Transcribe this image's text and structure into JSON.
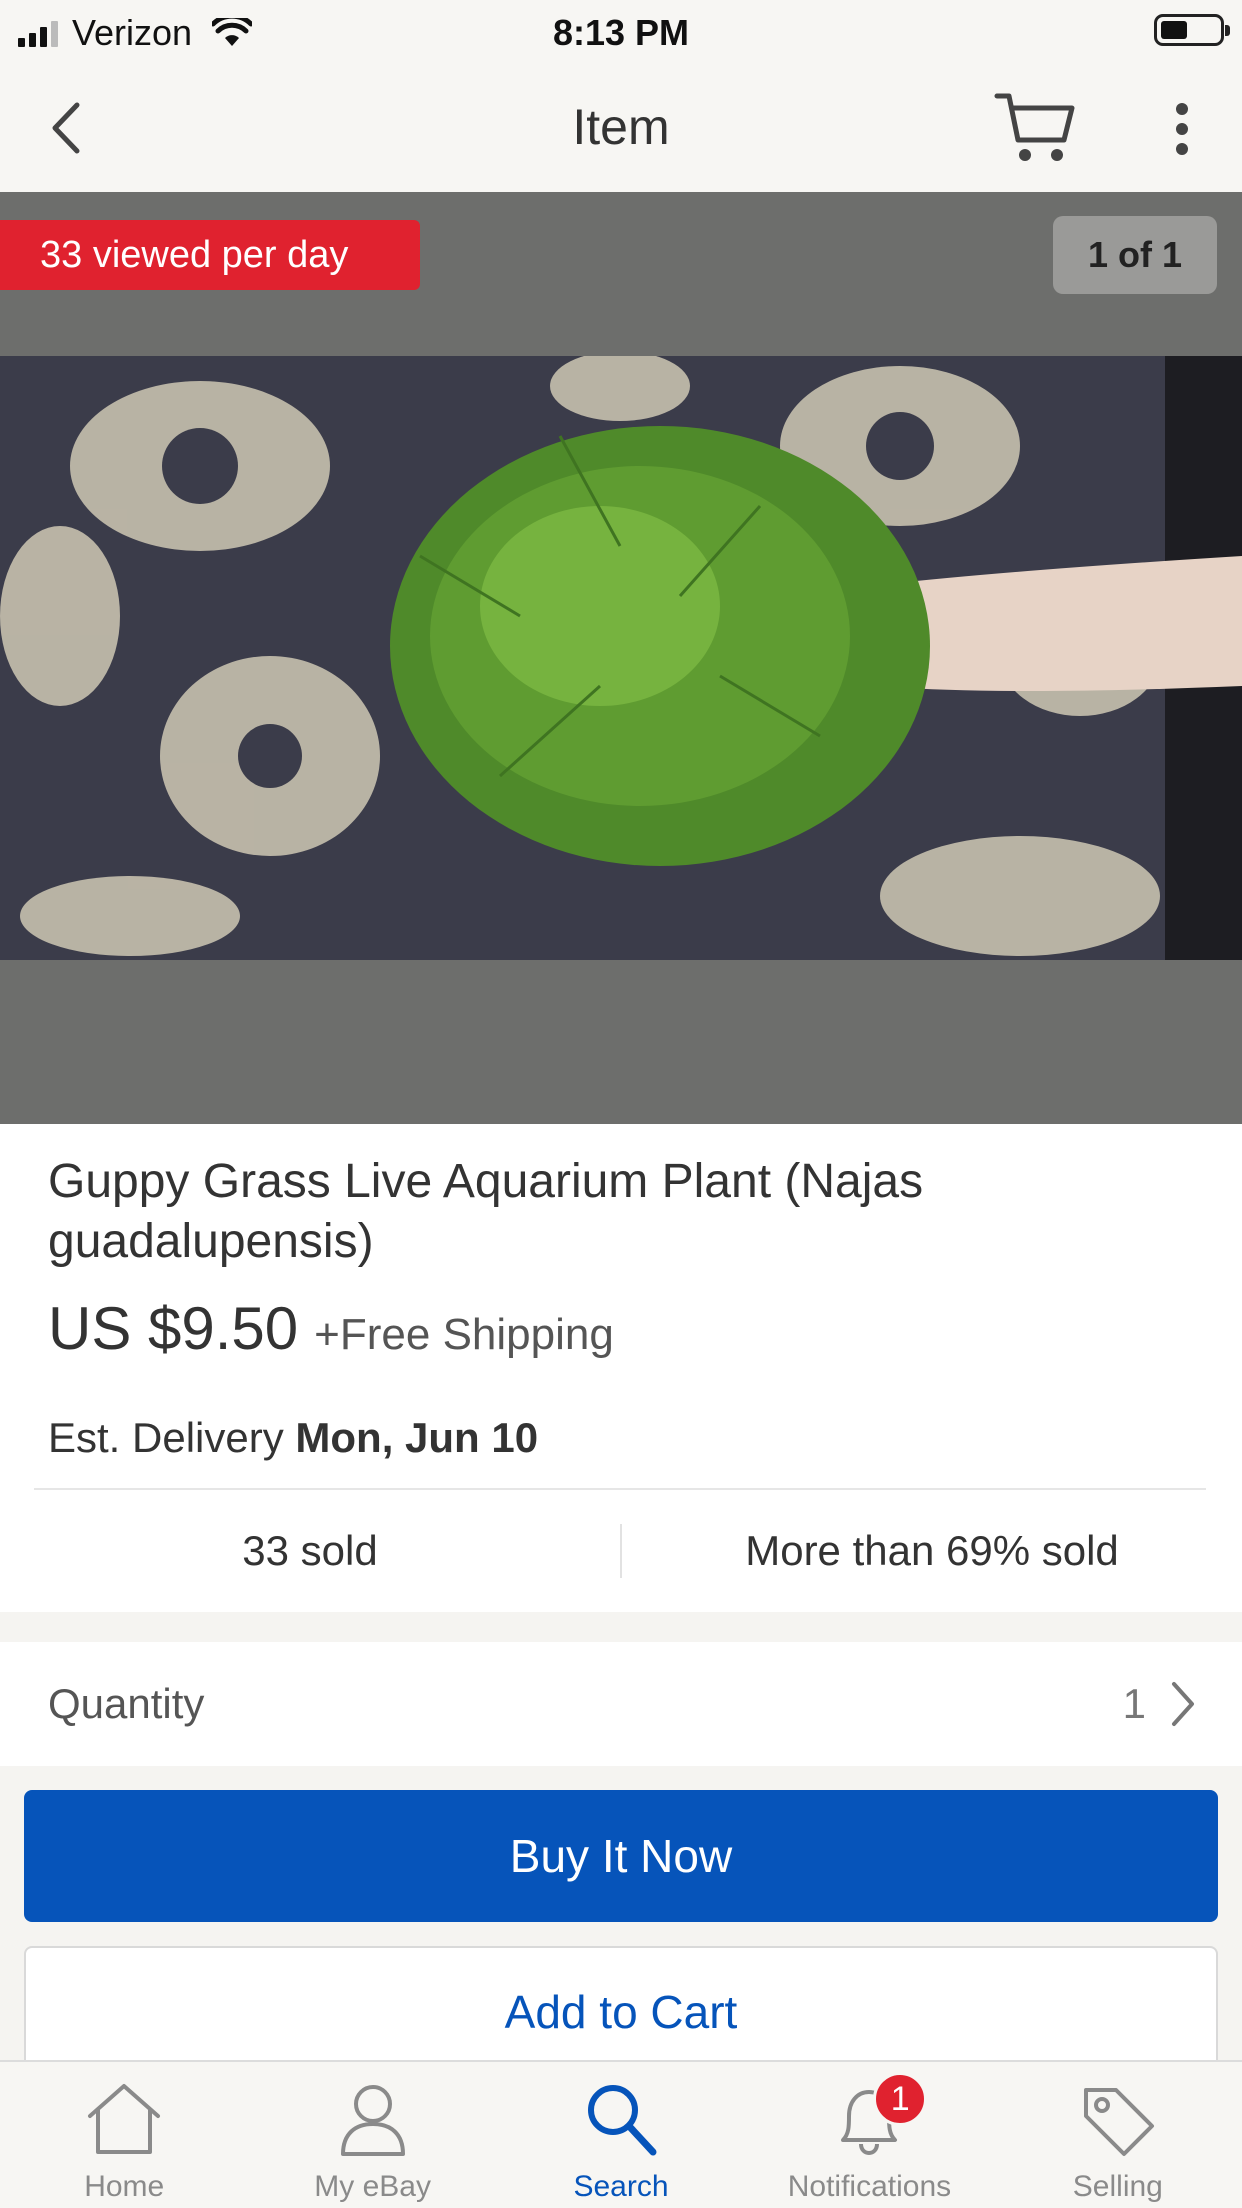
{
  "status_bar": {
    "carrier": "Verizon",
    "time": "8:13 PM",
    "battery_level": 0.4
  },
  "nav": {
    "title": "Item",
    "icons": [
      "chevron-left-icon",
      "cart-icon",
      "more-vertical-icon"
    ]
  },
  "gallery": {
    "views_badge": "33 viewed per day",
    "counter": "1 of 1",
    "badge_color": "#e0222f"
  },
  "item": {
    "title": "Guppy Grass Live Aquarium Plant (Najas guadalupensis)",
    "price": "US $9.50",
    "shipping": "+Free Shipping",
    "delivery_label": "Est. Delivery",
    "delivery_date": "Mon, Jun 10",
    "sold_count": "33 sold",
    "sold_percent": "More than 69% sold"
  },
  "quantity": {
    "label": "Quantity",
    "value": "1"
  },
  "actions": {
    "buy_now": "Buy It Now",
    "add_to_cart": "Add to Cart",
    "primary_color": "#0654ba"
  },
  "tabs": [
    {
      "label": "Home",
      "icon": "home-icon",
      "active": false
    },
    {
      "label": "My eBay",
      "icon": "user-icon",
      "active": false
    },
    {
      "label": "Search",
      "icon": "search-icon",
      "active": true
    },
    {
      "label": "Notifications",
      "icon": "bell-icon",
      "active": false,
      "badge": "1"
    },
    {
      "label": "Selling",
      "icon": "tag-icon",
      "active": false
    }
  ]
}
